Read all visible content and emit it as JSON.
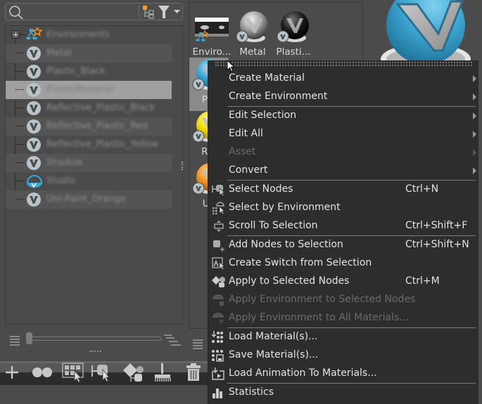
{
  "search": {
    "placeholder": "",
    "value": ""
  },
  "tree": {
    "root": {
      "label": "Environments",
      "icon": "environments-icon"
    },
    "items": [
      {
        "label": "Metal",
        "icon": "material-icon",
        "selected": false
      },
      {
        "label": "Plastic_Black",
        "icon": "material-icon",
        "selected": false
      },
      {
        "label": "PlasticMaterial",
        "icon": "material-icon",
        "selected": true
      },
      {
        "label": "Reflective_Plastic_Black",
        "icon": "material-icon",
        "selected": false
      },
      {
        "label": "Reflective_Plastic_Red",
        "icon": "material-icon",
        "selected": false
      },
      {
        "label": "Reflective_Plastic_Yellow",
        "icon": "material-icon",
        "selected": false
      },
      {
        "label": "Shadow",
        "icon": "material-icon",
        "selected": false
      },
      {
        "label": "Studio",
        "icon": "environment-icon",
        "selected": false
      },
      {
        "label": "Uni-Paint_Orange",
        "icon": "material-icon",
        "selected": false
      }
    ]
  },
  "gallery": {
    "thumbs": [
      {
        "label": "Enviro...",
        "kind": "environment"
      },
      {
        "label": "Metal",
        "kind": "metal"
      },
      {
        "label": "Plasti...",
        "kind": "black"
      },
      {
        "label": "Pla",
        "kind": "blue",
        "selected": true
      },
      {
        "label": "Ref",
        "kind": "yellow"
      },
      {
        "label": "Un",
        "kind": "orange"
      }
    ]
  },
  "toolbar": {
    "buttons": [
      "add-icon",
      "two-circles-icon",
      "select-grid-icon",
      "select-nodes-icon",
      "apply-icon",
      "broom-icon",
      "trash-icon"
    ]
  },
  "context_menu": {
    "items": [
      {
        "label": "Create Material",
        "submenu": true
      },
      {
        "label": "Create Environment",
        "submenu": true
      },
      {
        "separator": true
      },
      {
        "label": "Edit Selection",
        "submenu": true
      },
      {
        "label": "Edit All",
        "submenu": true
      },
      {
        "label": "Asset",
        "submenu": true,
        "disabled": true
      },
      {
        "label": "Convert",
        "submenu": true
      },
      {
        "separator": true
      },
      {
        "label": "Select Nodes",
        "shortcut": "Ctrl+N",
        "icon": "select-nodes-icon"
      },
      {
        "label": "Select by Environment",
        "icon": "select-by-environment-icon"
      },
      {
        "label": "Scroll To Selection",
        "shortcut": "Ctrl+Shift+F",
        "icon": "scroll-to-selection-icon"
      },
      {
        "separator": true
      },
      {
        "label": "Add Nodes to Selection",
        "shortcut": "Ctrl+Shift+N",
        "icon": "add-nodes-icon"
      },
      {
        "label": "Create Switch from Selection",
        "icon": "create-switch-icon"
      },
      {
        "label": "Apply to Selected Nodes",
        "shortcut": "Ctrl+M",
        "icon": "apply-to-nodes-icon"
      },
      {
        "label": "Apply Environment to Selected Nodes",
        "disabled": true,
        "icon": "apply-environment-icon"
      },
      {
        "label": "Apply Environment to All Materials...",
        "disabled": true,
        "icon": "apply-environment-all-icon"
      },
      {
        "separator": true
      },
      {
        "label": "Load Material(s)...",
        "icon": "load-materials-icon"
      },
      {
        "label": "Save Material(s)...",
        "icon": "save-materials-icon"
      },
      {
        "label": "Load Animation To Materials...",
        "icon": "load-animation-icon"
      },
      {
        "separator": true
      },
      {
        "label": "Statistics",
        "icon": "statistics-icon"
      }
    ]
  },
  "colors": {
    "background": "#4b4b4b",
    "menu_bg": "#2d2d2d",
    "accent_blue": "#3ba9d9",
    "accent_orange": "#f0901e",
    "selection": "#a0a0a0"
  }
}
